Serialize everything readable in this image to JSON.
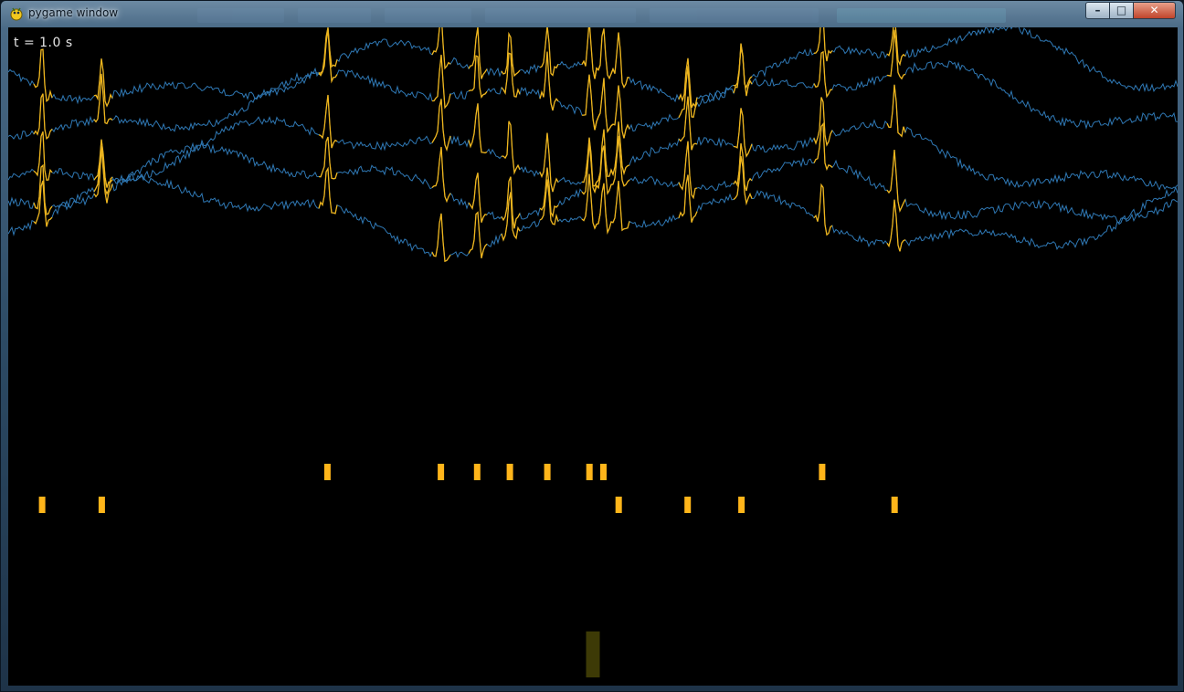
{
  "window": {
    "title": "pygame window",
    "icon": "pygame-snake-icon",
    "controls": {
      "minimize_icon": "minimize-icon",
      "maximize_icon": "maximize-icon",
      "close_icon": "close-icon"
    }
  },
  "overlay": {
    "time_label": "t = 1.0 s"
  },
  "colors": {
    "background": "#000000",
    "trace": "#2f78b4",
    "spike_trace": "#f0b51a",
    "spike_marker": "#ffb51a",
    "indicator": "#3d3a06"
  },
  "spike_rows": [
    {
      "row": 1,
      "times": [
        0.273,
        0.37,
        0.401,
        0.429,
        0.461,
        0.497,
        0.509,
        0.696
      ]
    },
    {
      "row": 2,
      "times": [
        0.029,
        0.08,
        0.522,
        0.581,
        0.627,
        0.758
      ]
    }
  ],
  "indicator": {
    "position": 0.5,
    "level": 0.7
  }
}
